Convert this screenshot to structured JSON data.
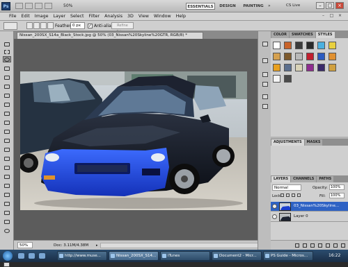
{
  "appbar": {
    "logo": "Ps",
    "zoom": "50%",
    "workspaces": [
      "ESSENTIALS",
      "DESIGN",
      "PAINTING"
    ],
    "more": "»",
    "cslive": "CS Live",
    "window_buttons": [
      "–",
      "□",
      "×"
    ]
  },
  "menu": [
    "File",
    "Edit",
    "Image",
    "Layer",
    "Select",
    "Filter",
    "Analysis",
    "3D",
    "View",
    "Window",
    "Help"
  ],
  "options": {
    "feather_label": "Feather:",
    "feather_value": "0 px",
    "antialias_label": "Anti-alias",
    "antialias_checked": "✓",
    "refine_edge": "Refine Edge..."
  },
  "tab": {
    "title": "Nissan_200SX_S14a_Black_Stock.jpg @ 50% (03_Nissan%20Skyline%20GTR, RGB/8) *"
  },
  "status": {
    "zoom": "50%",
    "doc": "Doc: 3.11M/4.38M",
    "arrow": "▸"
  },
  "panels": {
    "top_tabs": [
      "COLOR",
      "SWATCHES",
      "STYLES"
    ],
    "adj_tabs": [
      "ADJUSTMENTS",
      "MASKS"
    ],
    "layers_tabs": [
      "LAYERS",
      "CHANNELS",
      "PATHS"
    ],
    "blend_mode": "Normal",
    "opacity_label": "Opacity:",
    "opacity_value": "100%",
    "lock_label": "Lock:",
    "fill_label": "Fill:",
    "fill_value": "100%",
    "layers": [
      {
        "name": "03_Nissan%20Skyline..."
      },
      {
        "name": "Layer 0"
      }
    ]
  },
  "taskbar": {
    "buttons": [
      {
        "label": "http://www.muse..."
      },
      {
        "label": "Nissan_200SX_S14..."
      },
      {
        "label": "iTunes"
      },
      {
        "label": "Document2 - Micr..."
      },
      {
        "label": "PS Guide - Micros..."
      }
    ],
    "clock": "16:22"
  },
  "colors": {
    "accent_blue": "#2e62c4",
    "car_blue": "#1a3fd0",
    "close_red": "#c94a3b"
  }
}
